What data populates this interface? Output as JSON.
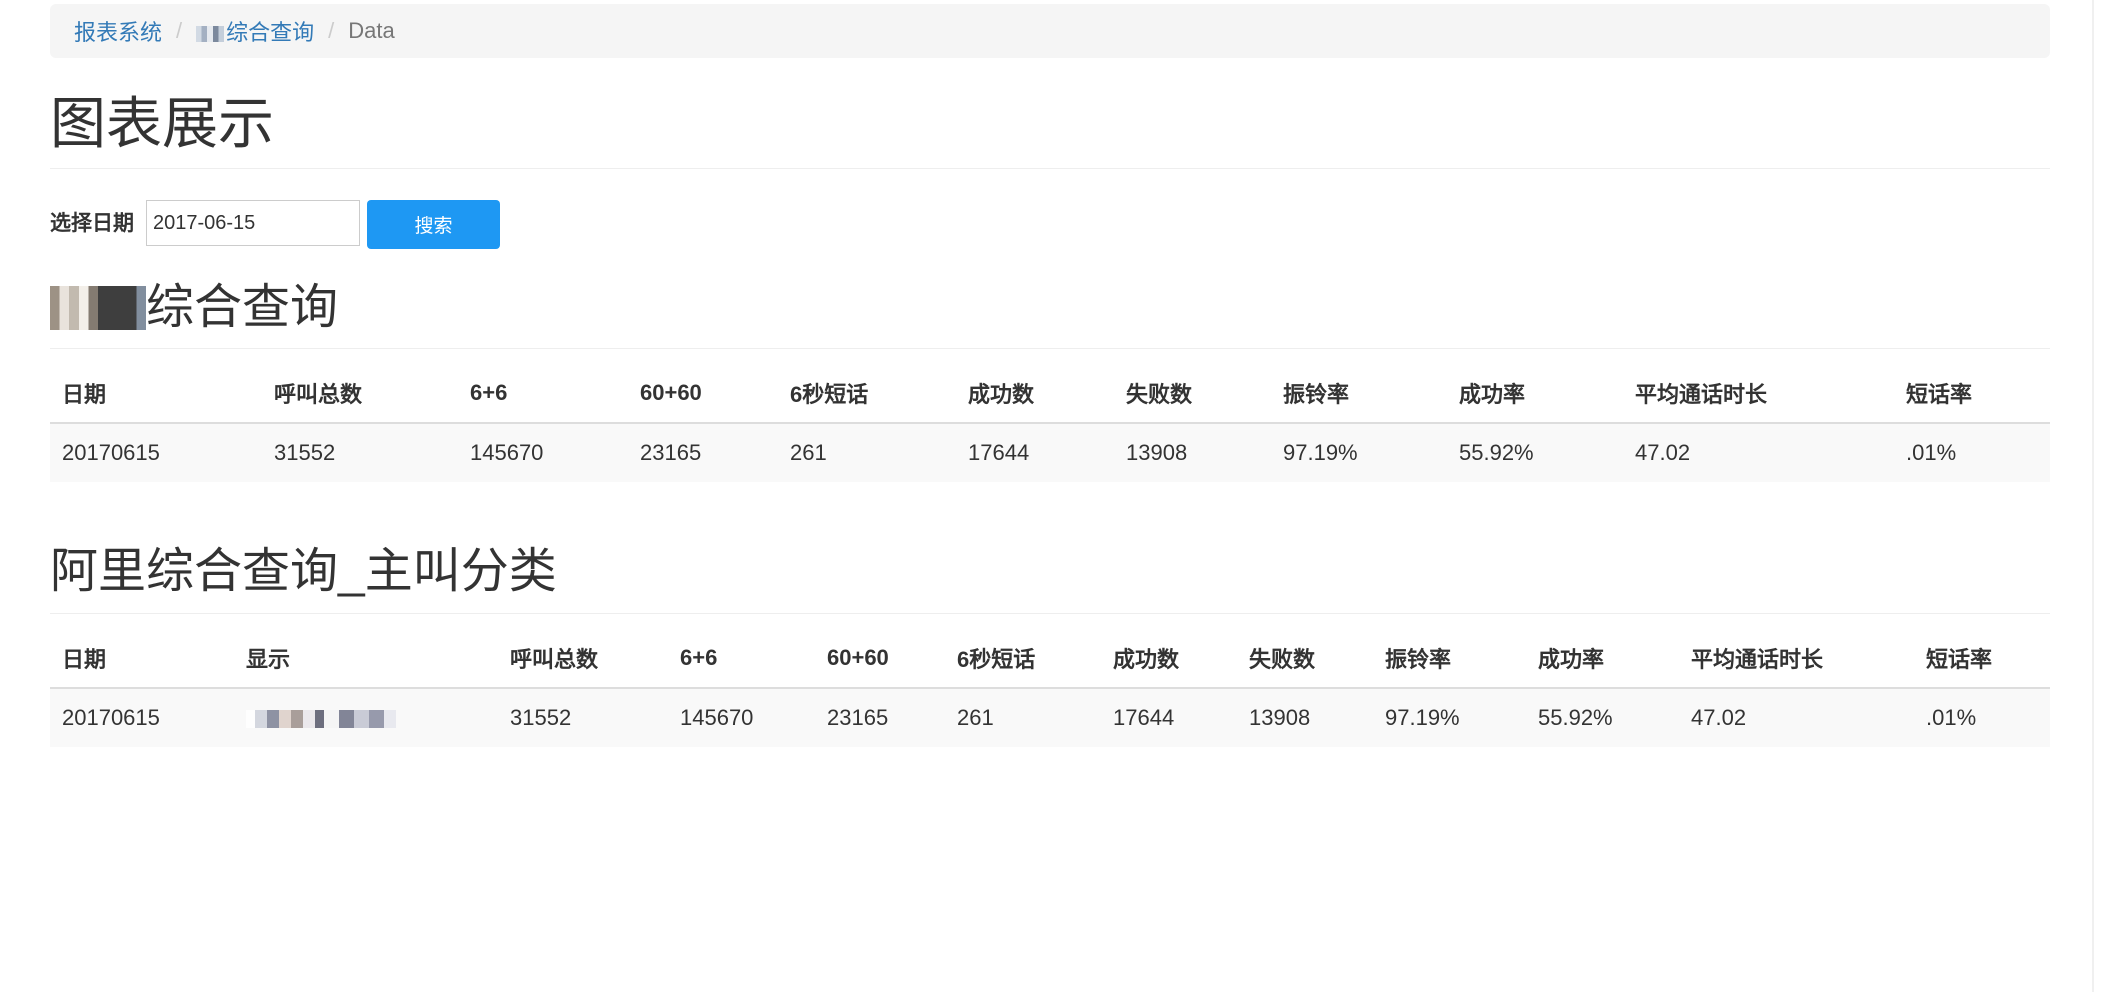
{
  "breadcrumb": {
    "items": [
      "报表系统",
      "综合查询",
      "Data"
    ],
    "separator": "/"
  },
  "page": {
    "title": "图表展示"
  },
  "filter": {
    "label": "选择日期",
    "date_value": "2017-06-15",
    "search_label": "搜索"
  },
  "section1": {
    "title": "综合查询",
    "columns": [
      "日期",
      "呼叫总数",
      "6+6",
      "60+60",
      "6秒短话",
      "成功数",
      "失败数",
      "振铃率",
      "成功率",
      "平均通话时长",
      "短话率"
    ],
    "rows": [
      [
        "20170615",
        "31552",
        "145670",
        "23165",
        "261",
        "17644",
        "13908",
        "97.19%",
        "55.92%",
        "47.02",
        ".01%"
      ]
    ]
  },
  "section2": {
    "title": "阿里综合查询_主叫分类",
    "columns": [
      "日期",
      "显示",
      "呼叫总数",
      "6+6",
      "60+60",
      "6秒短话",
      "成功数",
      "失败数",
      "振铃率",
      "成功率",
      "平均通话时长",
      "短话率"
    ],
    "rows": [
      [
        "20170615",
        "",
        "31552",
        "145670",
        "23165",
        "261",
        "17644",
        "13908",
        "97.19%",
        "55.92%",
        "47.02",
        ".01%"
      ]
    ]
  },
  "colors": {
    "link": "#337ab7",
    "button": "#1e98f3",
    "breadcrumb_bg": "#f5f5f5",
    "row_bg": "#f9f9f9"
  }
}
